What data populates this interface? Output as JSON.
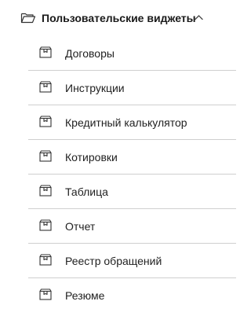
{
  "header": {
    "title": "Пользовательские виджеты",
    "folder_icon": "folder-open-icon",
    "toggle_icon": "chevron-up-icon"
  },
  "items": [
    {
      "label": "Договоры",
      "icon": "widget-box-icon"
    },
    {
      "label": "Инструкции",
      "icon": "widget-box-icon"
    },
    {
      "label": "Кредитный калькулятор",
      "icon": "widget-box-icon"
    },
    {
      "label": "Котировки",
      "icon": "widget-box-icon"
    },
    {
      "label": "Таблица",
      "icon": "widget-box-icon"
    },
    {
      "label": "Отчет",
      "icon": "widget-box-icon"
    },
    {
      "label": "Реестр обращений",
      "icon": "widget-box-icon"
    },
    {
      "label": "Резюме",
      "icon": "widget-box-icon"
    }
  ],
  "colors": {
    "text": "#222222",
    "divider": "#cfcfcf",
    "icon_stroke": "#333333"
  }
}
